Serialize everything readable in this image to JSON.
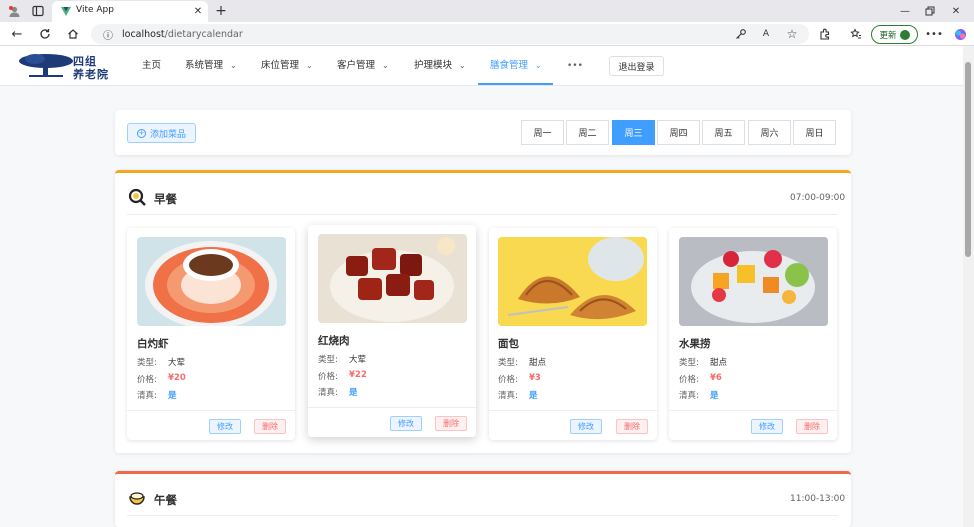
{
  "browser": {
    "tab_title": "Vite App",
    "url_host": "localhost",
    "url_path": "/dietarycalendar",
    "update_label": "更新"
  },
  "nav": {
    "logo_line1": "四组",
    "logo_line2": "养老院",
    "items": [
      {
        "label": "主页"
      },
      {
        "label": "系统管理"
      },
      {
        "label": "床位管理"
      },
      {
        "label": "客户管理"
      },
      {
        "label": "护理模块"
      },
      {
        "label": "膳食管理"
      }
    ],
    "more": "•••",
    "logout": "退出登录"
  },
  "toolbar": {
    "add_label": "添加菜品",
    "days": [
      "周一",
      "周二",
      "周三",
      "周四",
      "周五",
      "周六",
      "周日"
    ],
    "active_day": "周三"
  },
  "breakfast": {
    "title": "早餐",
    "time": "07:00-09:00",
    "accent": "#f5a623",
    "foods": [
      {
        "name": "白灼虾",
        "type_label": "类型:",
        "type": "大荤",
        "price_label": "价格:",
        "price": "¥20",
        "halal_label": "清真:",
        "halal": "是",
        "edit": "修改",
        "delete": "删除"
      },
      {
        "name": "红烧肉",
        "type_label": "类型:",
        "type": "大荤",
        "price_label": "价格:",
        "price": "¥22",
        "halal_label": "清真:",
        "halal": "是",
        "edit": "修改",
        "delete": "删除"
      },
      {
        "name": "面包",
        "type_label": "类型:",
        "type": "甜点",
        "price_label": "价格:",
        "price": "¥3",
        "halal_label": "清真:",
        "halal": "是",
        "edit": "修改",
        "delete": "删除"
      },
      {
        "name": "水果捞",
        "type_label": "类型:",
        "type": "甜点",
        "price_label": "价格:",
        "price": "¥6",
        "halal_label": "清真:",
        "halal": "是",
        "edit": "修改",
        "delete": "删除"
      }
    ]
  },
  "lunch": {
    "title": "午餐",
    "time": "11:00-13:00",
    "accent": "#f06a4a"
  },
  "colors": {
    "primary": "#409eff",
    "price": "#f56c6c",
    "halal": "#409eff"
  }
}
